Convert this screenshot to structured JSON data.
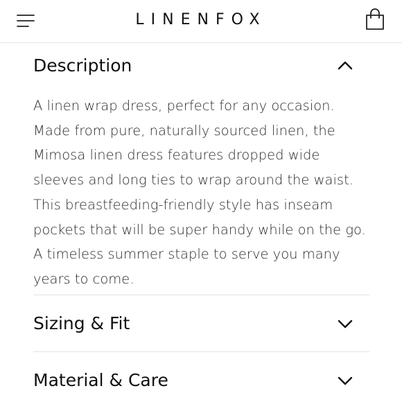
{
  "header": {
    "brand": "LINENFOX"
  },
  "sections": {
    "description": {
      "title": "Description",
      "expanded": true,
      "body": "A linen wrap dress, perfect for any occasion. Made from pure, naturally sourced linen, the Mimosa linen dress features dropped wide sleeves and long ties to wrap around the waist. This breastfeeding-friendly style has inseam pockets that will be super handy while on the go.  A timeless summer staple to serve you many years to come."
    },
    "sizing": {
      "title": "Sizing & Fit",
      "expanded": false
    },
    "material": {
      "title": "Material & Care",
      "expanded": false
    }
  },
  "icons": {
    "menu": "hamburger-menu-icon",
    "bag": "shopping-bag-icon",
    "collapse": "chevron-up-icon",
    "expand": "chevron-down-icon"
  }
}
